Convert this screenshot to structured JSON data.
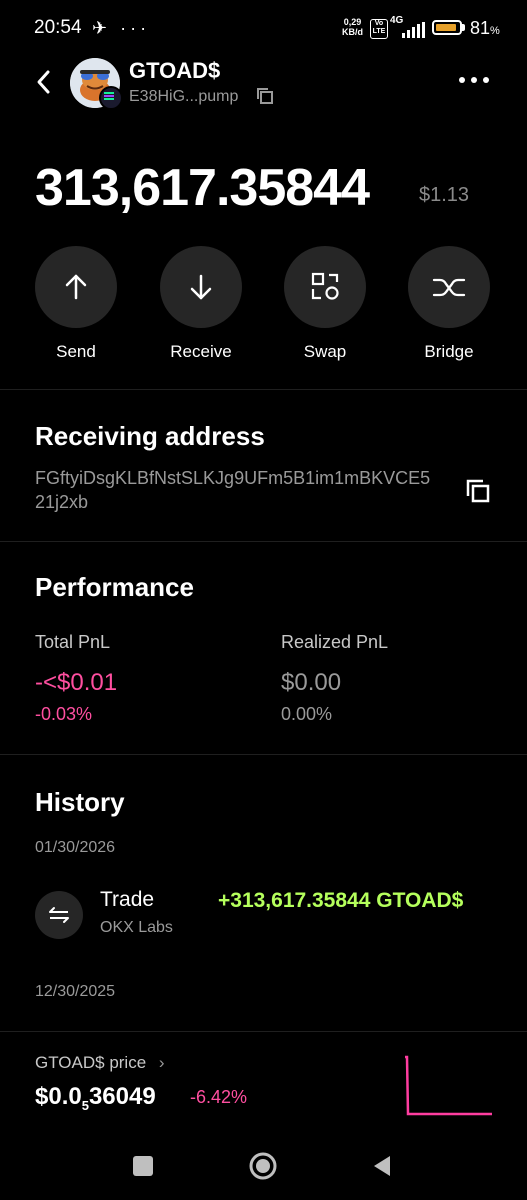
{
  "status_bar": {
    "time": "20:54",
    "icons": "✈ ···",
    "net_speed_value": "0,29",
    "net_speed_unit": "KB/d",
    "volte": "Vo LTE",
    "network": "4G",
    "battery_percent": "81",
    "battery_symbol": "%",
    "battery_color": "#e7a12a"
  },
  "header": {
    "token_name": "GTOAD$",
    "contract_short": "E38HiG...pump"
  },
  "balance": {
    "amount": "313,617.35844",
    "usd_value": "$1.13"
  },
  "actions": [
    {
      "label": "Send",
      "icon": "arrow-up-icon"
    },
    {
      "label": "Receive",
      "icon": "arrow-down-icon"
    },
    {
      "label": "Swap",
      "icon": "swap-icon"
    },
    {
      "label": "Bridge",
      "icon": "bridge-icon"
    }
  ],
  "receiving": {
    "title": "Receiving address",
    "address": "FGftyiDsgKLBfNstSLKJg9UFm5B1im1mBKVCE521j2xb"
  },
  "performance": {
    "title": "Performance",
    "total_label": "Total PnL",
    "total_value": "-<$0.01",
    "total_pct": "-0.03%",
    "realized_label": "Realized PnL",
    "realized_value": "$0.00",
    "realized_pct": "0.00%"
  },
  "history": {
    "title": "History",
    "groups": [
      {
        "date": "01/30/2026",
        "items": [
          {
            "title": "Trade",
            "subtitle": "OKX Labs",
            "amount": "+313,617.35844 GTOAD$"
          }
        ]
      },
      {
        "date": "12/30/2025",
        "items": []
      }
    ]
  },
  "price_bar": {
    "label": "GTOAD$ price",
    "price_prefix": "$0.0",
    "price_subscript": "5",
    "price_suffix": "36049",
    "change": "-6.42%"
  },
  "colors": {
    "positive": "#b5ff5c",
    "negative": "#ff4fa0",
    "muted": "#9a9a9a",
    "button_bg": "#262626"
  }
}
